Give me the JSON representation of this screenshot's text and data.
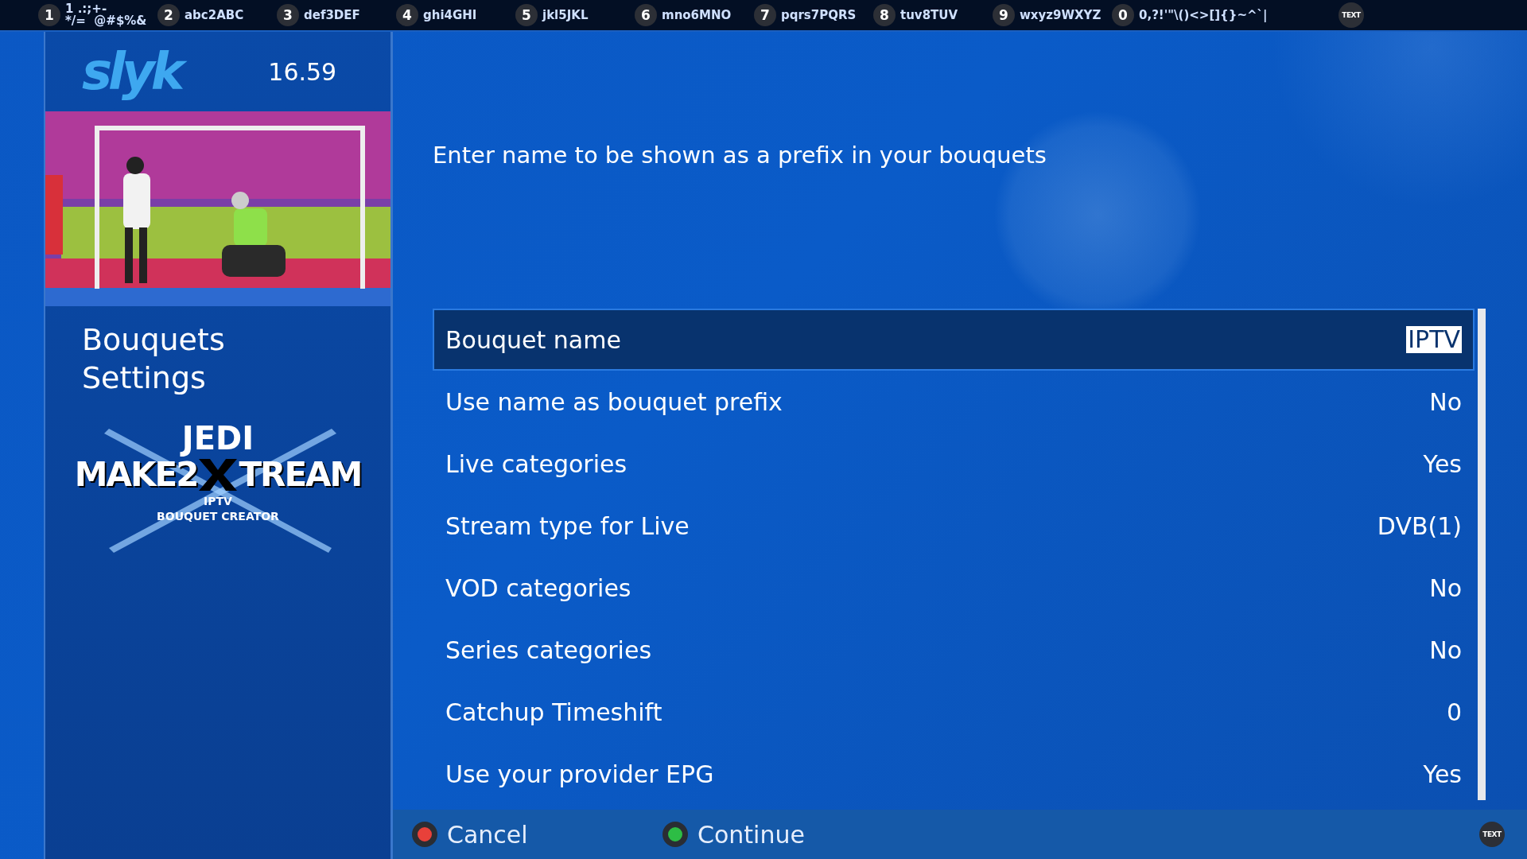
{
  "keypad": [
    {
      "key": "1",
      "lines": [
        "1 .:;+-",
        "*/=  @#$%&"
      ]
    },
    {
      "key": "2",
      "lines": [
        "abc2ABC"
      ]
    },
    {
      "key": "3",
      "lines": [
        "def3DEF"
      ]
    },
    {
      "key": "4",
      "lines": [
        "ghi4GHI"
      ]
    },
    {
      "key": "5",
      "lines": [
        "jkl5JKL"
      ]
    },
    {
      "key": "6",
      "lines": [
        "mno6MNO"
      ]
    },
    {
      "key": "7",
      "lines": [
        "pqrs7PQRS"
      ]
    },
    {
      "key": "8",
      "lines": [
        "tuv8TUV"
      ]
    },
    {
      "key": "9",
      "lines": [
        "wxyz9WXYZ"
      ]
    },
    {
      "key": "0",
      "lines": [
        "0,?!'\"\\()<>[]{}~^`|"
      ]
    }
  ],
  "keypad_badge": "TEXT",
  "sidebar": {
    "logo": "slyk",
    "time": "16.59",
    "title_lines": [
      "Bouquets",
      "Settings"
    ],
    "plugin_logo": {
      "top": "JEDI",
      "main_left": "MAKE2",
      "main_right": "TREAM",
      "sub_lines": [
        "IPTV",
        "BOUQUET CREATOR"
      ]
    }
  },
  "prompt": "Enter name to be shown as a prefix in your bouquets",
  "settings": [
    {
      "label": "Bouquet name",
      "value": "IPTV",
      "kind": "text",
      "selected": true
    },
    {
      "label": "Use name as bouquet prefix",
      "value": "No",
      "kind": "option",
      "selected": false
    },
    {
      "label": "Live categories",
      "value": "Yes",
      "kind": "option",
      "selected": false
    },
    {
      "label": "Stream type for Live",
      "value": "DVB(1)",
      "kind": "option",
      "selected": false
    },
    {
      "label": "VOD categories",
      "value": "No",
      "kind": "option",
      "selected": false
    },
    {
      "label": "Series categories",
      "value": "No",
      "kind": "option",
      "selected": false
    },
    {
      "label": "Catchup Timeshift",
      "value": "0",
      "kind": "option",
      "selected": false
    },
    {
      "label": "Use your provider EPG",
      "value": "Yes",
      "kind": "option",
      "selected": false
    }
  ],
  "footer": {
    "buttons": [
      {
        "label": "Cancel",
        "color": "#e8413a"
      },
      {
        "label": "Continue",
        "color": "#2dbd45"
      }
    ],
    "badge": "TEXT"
  }
}
